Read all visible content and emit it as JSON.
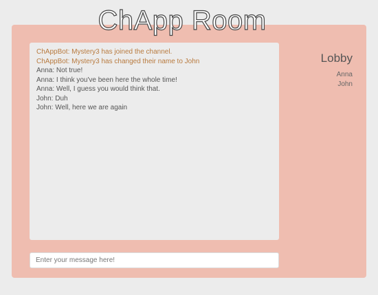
{
  "app": {
    "title": "ChApp Room"
  },
  "chat": {
    "messages": [
      {
        "text": "ChAppBot: Mystery3 has joined the channel.",
        "kind": "bot"
      },
      {
        "text": "ChAppBot: Mystery3 has changed their name to John",
        "kind": "bot"
      },
      {
        "text": "Anna: Not true!",
        "kind": "user"
      },
      {
        "text": "Anna: I think you've been here the whole time!",
        "kind": "user"
      },
      {
        "text": "Anna: Well, I guess you would think that.",
        "kind": "user"
      },
      {
        "text": "John: Duh",
        "kind": "user"
      },
      {
        "text": "John: Well, here we are again",
        "kind": "user"
      }
    ],
    "input_placeholder": "Enter your message here!",
    "input_value": ""
  },
  "sidebar": {
    "room_name": "Lobby",
    "users": [
      "Anna",
      "John"
    ]
  },
  "colors": {
    "page_background": "#ececec",
    "panel_background": "#efbdb0",
    "bot_message": "#b87a3e",
    "user_message": "#555555"
  }
}
